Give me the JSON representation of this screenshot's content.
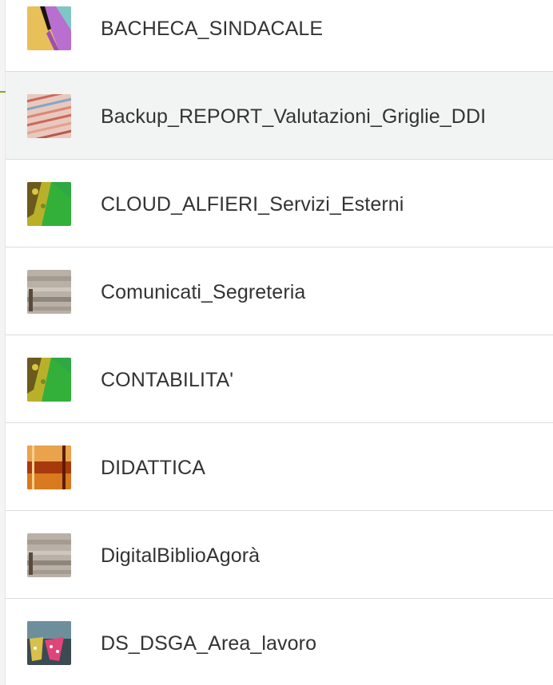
{
  "folders": [
    {
      "name": "BACHECA_SINDACALE",
      "thumbnail": "abstract-pink-yellow-thumb",
      "selected": false
    },
    {
      "name": "Backup_REPORT_Valutazioni_Griglie_DDI",
      "thumbnail": "pastel-stripes-thumb",
      "selected": true
    },
    {
      "name": "CLOUD_ALFIERI_Servizi_Esterni",
      "thumbnail": "green-yellow-texture-thumb",
      "selected": false
    },
    {
      "name": "Comunicati_Segreteria",
      "thumbnail": "wood-texture-thumb",
      "selected": false
    },
    {
      "name": "CONTABILITA'",
      "thumbnail": "green-yellow-texture-thumb",
      "selected": false
    },
    {
      "name": "DIDATTICA",
      "thumbnail": "amber-glass-thumb",
      "selected": false
    },
    {
      "name": "DigitalBiblioAgorà",
      "thumbnail": "wood-texture-thumb",
      "selected": false
    },
    {
      "name": "DS_DSGA_Area_lavoro",
      "thumbnail": "pink-flags-thumb",
      "selected": false
    }
  ],
  "colors": {
    "text": "#333333",
    "divider": "#dcdcdc",
    "selected_row": "#f2f3f3",
    "accent": "#8aa51f"
  }
}
